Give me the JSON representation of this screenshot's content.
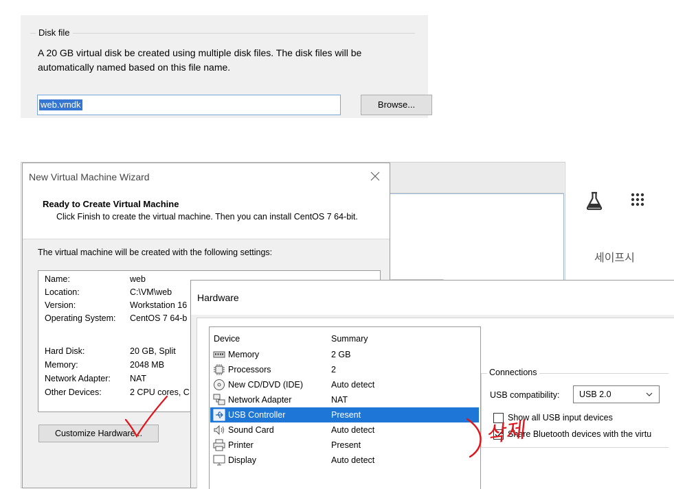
{
  "disk_file": {
    "legend": "Disk file",
    "description": "A 20 GB virtual disk be created using multiple disk files. The disk files will be automatically named based on this file name.",
    "filename_value": "web.vmdk",
    "browse_label": "Browse..."
  },
  "background_app": {
    "korean_text": "세이프시",
    "flask_icon": "flask-icon",
    "grid_icon": "app-grid-icon"
  },
  "wizard": {
    "title": "New Virtual Machine Wizard",
    "heading": "Ready to Create Virtual Machine",
    "subtext": "Click Finish to create the virtual machine. Then you can install CentOS 7 64-bit.",
    "intro": "The virtual machine will be created with the following settings:",
    "settings": [
      {
        "label": "Name:",
        "value": "web"
      },
      {
        "label": "Location:",
        "value": "C:\\VM\\web"
      },
      {
        "label": "Version:",
        "value": "Workstation 16"
      },
      {
        "label": "Operating System:",
        "value": "CentOS 7 64-b"
      },
      {
        "label": "Hard Disk:",
        "value": "20 GB, Split"
      },
      {
        "label": "Memory:",
        "value": "2048 MB"
      },
      {
        "label": "Network Adapter:",
        "value": "NAT"
      },
      {
        "label": "Other Devices:",
        "value": "2 CPU cores, C"
      }
    ],
    "customize_label": "Customize Hardware..."
  },
  "hardware": {
    "title": "Hardware",
    "col_device": "Device",
    "col_summary": "Summary",
    "devices": [
      {
        "name": "Memory",
        "summary": "2 GB",
        "icon": "memory-icon"
      },
      {
        "name": "Processors",
        "summary": "2",
        "icon": "processor-icon"
      },
      {
        "name": "New CD/DVD (IDE)",
        "summary": "Auto detect",
        "icon": "cd-dvd-icon"
      },
      {
        "name": "Network Adapter",
        "summary": "NAT",
        "icon": "network-adapter-icon"
      },
      {
        "name": "USB Controller",
        "summary": "Present",
        "icon": "usb-controller-icon"
      },
      {
        "name": "Sound Card",
        "summary": "Auto detect",
        "icon": "sound-card-icon"
      },
      {
        "name": "Printer",
        "summary": "Present",
        "icon": "printer-icon"
      },
      {
        "name": "Display",
        "summary": "Auto detect",
        "icon": "display-icon"
      }
    ],
    "selected_device": "USB Controller",
    "connections": {
      "legend": "Connections",
      "usb_label": "USB compatibility:",
      "usb_value": "USB 2.0",
      "show_all_label": "Show all USB input devices",
      "show_all_checked": false,
      "bluetooth_label": "Share Bluetooth devices with the virtu",
      "bluetooth_checked": true
    }
  },
  "annotation": {
    "handwritten_text": "삭제",
    "color": "#e0151b"
  },
  "colors": {
    "selection": "#1e76d6",
    "text_selection": "#3476d2",
    "annotation_red": "#e0151b"
  }
}
